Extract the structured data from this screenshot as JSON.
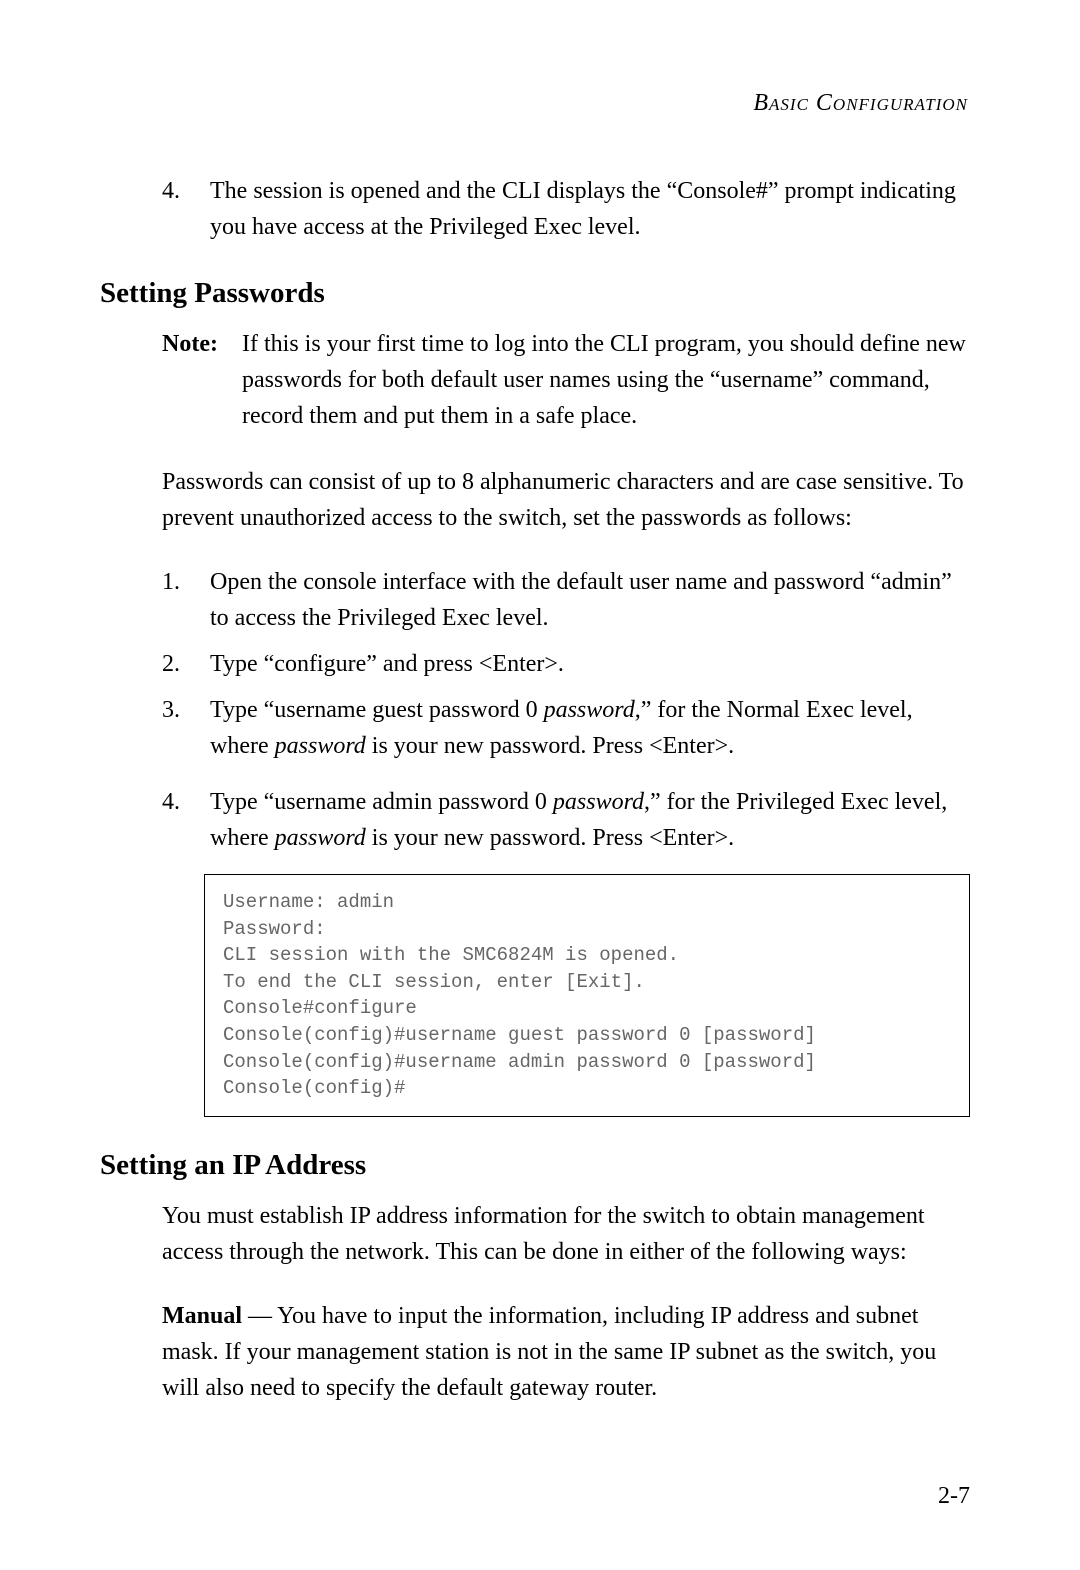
{
  "header": "Basic Configuration",
  "topList": {
    "num": "4.",
    "text": "The session is opened and the CLI displays the “Console#” prompt indicating you have access at the Privileged Exec level."
  },
  "section1": {
    "heading": "Setting Passwords",
    "noteLabel": "Note:",
    "noteText": "If this is your first time to log into the CLI program, you should define new passwords for both default user names using the “username” command, record them and put them in a safe place.",
    "para": "Passwords can consist of up to 8 alphanumeric characters and are case sensitive. To prevent unauthorized access to the switch, set the passwords as follows:",
    "items": [
      {
        "num": "1.",
        "text": "Open the console interface with the default user name and password “admin” to access the Privileged Exec level."
      },
      {
        "num": "2.",
        "text": "Type “configure” and press <Enter>."
      }
    ],
    "item3": {
      "num": "3.",
      "pre": "Type “username guest password 0 ",
      "em1": "password",
      "mid": ",” for the Normal Exec level, where ",
      "em2": "password",
      "post": " is your new password. Press <Enter>."
    },
    "item4": {
      "num": "4.",
      "pre": "Type “username admin password 0 ",
      "em1": "password",
      "mid": ",” for the Privileged Exec level, where ",
      "em2": "password",
      "post": " is your new password. Press <Enter>."
    },
    "code": "Username: admin\nPassword:\nCLI session with the SMC6824M is opened.\nTo end the CLI session, enter [Exit].\nConsole#configure\nConsole(config)#username guest password 0 [password]\nConsole(config)#username admin password 0 [password]\nConsole(config)#"
  },
  "section2": {
    "heading": "Setting an IP Address",
    "para1": "You must establish IP address information for the switch to obtain management access through the network. This can be done in either of the following ways:",
    "manualLabel": "Manual",
    "manualSep": " — ",
    "manualText": "You have to input the information, including IP address and subnet mask. If your management station is not in the same IP subnet as the switch, you will also need to specify the default gateway router."
  },
  "pageNumber": "2-7"
}
